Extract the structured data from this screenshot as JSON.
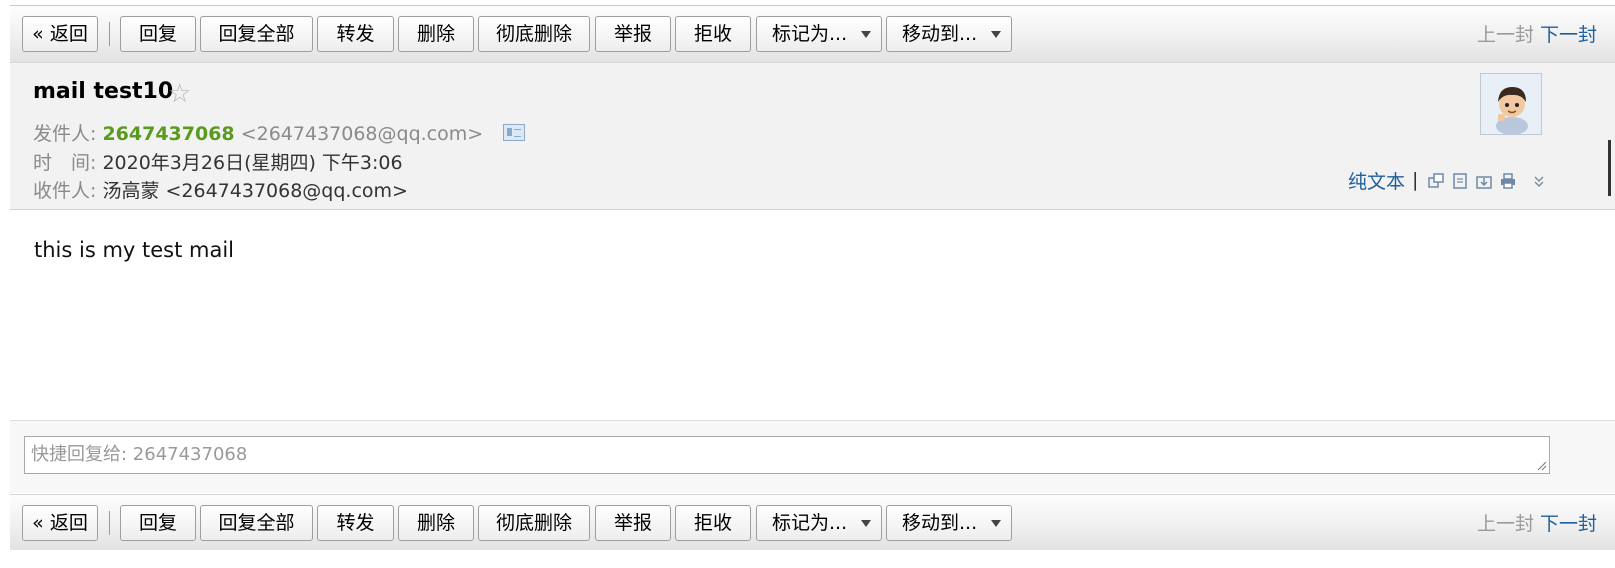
{
  "toolbar": {
    "back": "« 返回",
    "reply": "回复",
    "reply_all": "回复全部",
    "forward": "转发",
    "delete": "删除",
    "delete_permanently": "彻底删除",
    "report": "举报",
    "reject": "拒收",
    "mark_as": "标记为...",
    "move_to": "移动到...",
    "prev_mail": "上一封",
    "next_mail": "下一封"
  },
  "mail": {
    "subject": "mail test10",
    "from_label": "发件人:",
    "from_name": "2647437068",
    "from_email": "<2647437068@qq.com>",
    "time_label": "时　间:",
    "time_value": "2020年3月26日(星期四) 下午3:06",
    "to_label": "收件人:",
    "to_value": "汤高蒙 <2647437068@qq.com>",
    "body": "this is my test mail"
  },
  "header_actions": {
    "plain_text": "纯文本",
    "separator": "|"
  },
  "quick_reply": {
    "placeholder": "快捷回复给: 2647437068"
  },
  "icons": [
    "star-icon",
    "contact-card-icon",
    "avatar",
    "new-window-icon",
    "note-icon",
    "download-icon",
    "print-icon",
    "more-chevron-icon"
  ],
  "colors": {
    "sender_name": "#5a9a1f",
    "link": "#1f5f9b",
    "disabled": "#9a9a9a"
  }
}
